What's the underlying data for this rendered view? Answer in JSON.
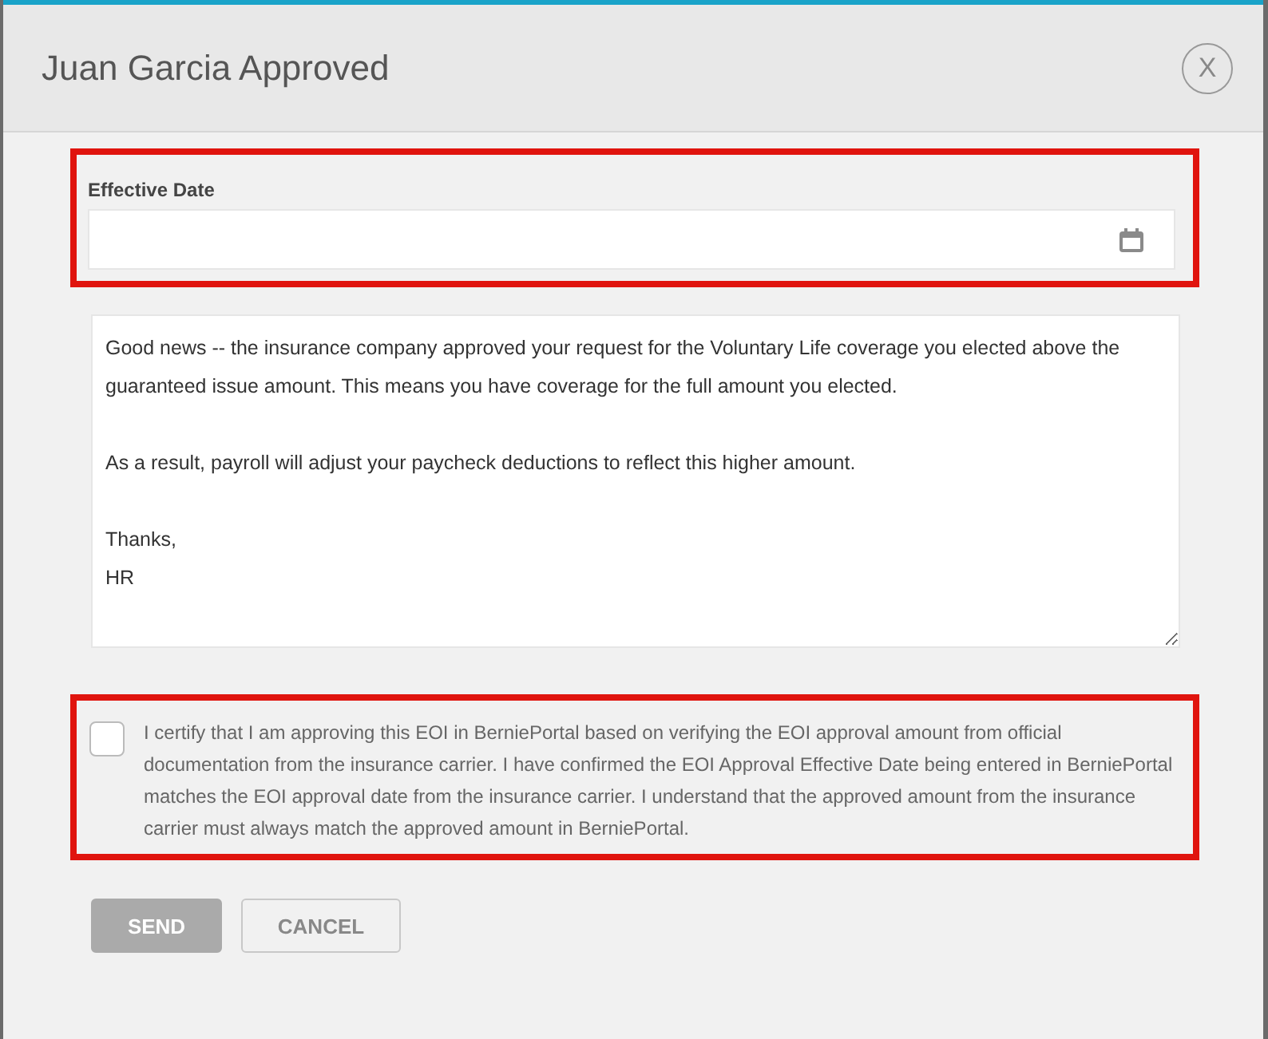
{
  "dialog": {
    "title": "Juan Garcia Approved",
    "close_label": "X"
  },
  "effective_date": {
    "label": "Effective Date"
  },
  "message": {
    "value": "Good news -- the insurance company approved your request for the Voluntary Life coverage you elected above the guaranteed issue amount. This means you have coverage for the full amount you elected.\n\nAs a result, payroll will adjust your paycheck deductions to reflect this higher amount.\n\nThanks,\nHR"
  },
  "certify": {
    "checked": false,
    "text": "I certify that I am approving this EOI in BerniePortal based on verifying the EOI approval amount from official documentation from the insurance carrier. I have confirmed the EOI Approval Effective Date being entered in BerniePortal matches the EOI approval date from the insurance carrier. I understand that the approved amount from the insurance carrier must always match the approved amount in BerniePortal."
  },
  "buttons": [
    {
      "kind": "primary",
      "label": "SEND",
      "disabled": true
    },
    {
      "kind": "secondary",
      "label": "CANCEL",
      "disabled": false
    }
  ]
}
